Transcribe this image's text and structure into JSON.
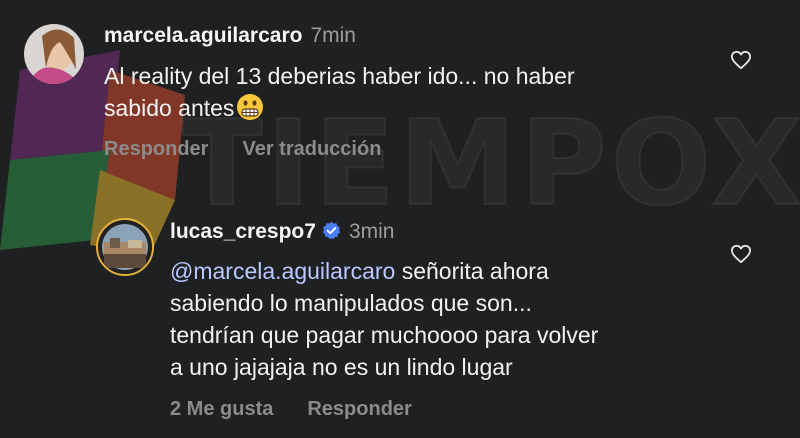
{
  "watermark": {
    "text": "TIEMPOX",
    "logo_icon": "tiempox-logo-icon"
  },
  "comments": [
    {
      "username": "marcela.aguilarcaro",
      "time": "7min",
      "text_line1": "Al reality del 13 deberias haber ido... no haber",
      "text_line2": "sabido antes",
      "emoji_icon": "grimacing-face-icon",
      "actions": [
        "Responder",
        "Ver traducción"
      ]
    },
    {
      "username": "lucas_crespo7",
      "verified": true,
      "time": "3min",
      "mention": "@marcela.aguilarcaro",
      "text_line1_rest": " señorita ahora",
      "text_line2": "sabiendo lo manipulados que son...",
      "text_line3": "tendrían que pagar muchoooo para volver",
      "text_line4": "a uno jajajaja no es un lindo lugar",
      "actions": [
        "2 Me gusta",
        "Responder"
      ]
    }
  ],
  "colors": {
    "background": "#1f2021",
    "mention": "#b9c8ff",
    "verified": "#4a7cf5",
    "secondary_text": "#8b8b8b"
  }
}
